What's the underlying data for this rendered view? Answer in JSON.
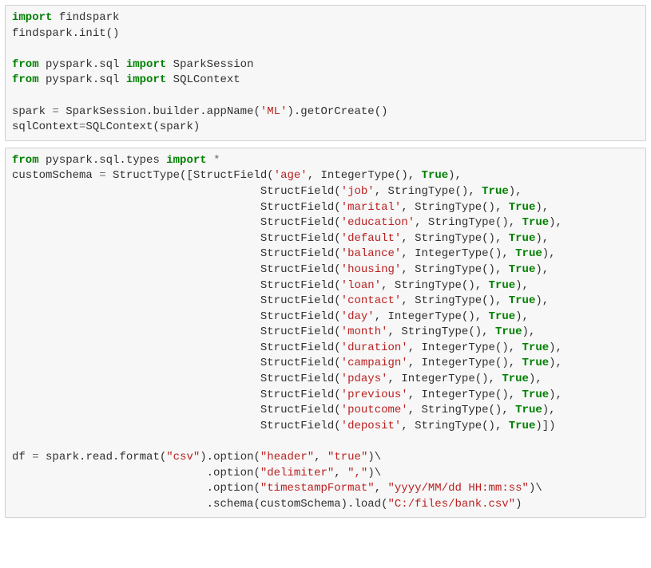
{
  "kw": {
    "import": "import",
    "from": "from",
    "star": "*"
  },
  "bool": {
    "True": "True"
  },
  "cell1": {
    "findspark": "findspark",
    "findspark_init": "findspark.init()",
    "pyspark_sql": "pyspark.sql",
    "SparkSession": "SparkSession",
    "SQLContext": "SQLContext",
    "spark": "spark",
    "eq": "=",
    "builder": "SparkSession.builder.appName(",
    "ml_str": "'ML'",
    "getOrCreate": ").getOrCreate()",
    "sqlctx_lhs": "sqlContext",
    "sqlctx_rhs1": "SQLContext(spark",
    "sqlctx_rhs2": ")"
  },
  "cell2": {
    "pyspark_sql_types": "pyspark.sql.types",
    "customSchema": "customSchema",
    "eq": "=",
    "StructType_open": "StructType([StructField(",
    "StructField_open": "StructField(",
    "mid": ", ",
    "IntegerType": "IntegerType(), ",
    "StringType": "StringType(), ",
    "close_item": "),",
    "close_last": ")])",
    "fields": {
      "age": "'age'",
      "job": "'job'",
      "marital": "'marital'",
      "education": "'education'",
      "default": "'default'",
      "balance": "'balance'",
      "housing": "'housing'",
      "loan": "'loan'",
      "contact": "'contact'",
      "day": "'day'",
      "month": "'month'",
      "duration": "'duration'",
      "campaign": "'campaign'",
      "pdays": "'pdays'",
      "previous": "'previous'",
      "poutcome": "'poutcome'",
      "deposit": "'deposit'"
    },
    "df": "df",
    "read_format": "spark.read.format(",
    "csv": "\"csv\"",
    "option": ").option(",
    "header": "\"header\"",
    "true_str": "\"true\"",
    "bsl": ")\\",
    "dot_option": ".option(",
    "delimiter": "\"delimiter\"",
    "comma": "\",\"",
    "tsfmt": "\"timestampFormat\"",
    "tsfmt_val": "\"yyyy/MM/dd HH:mm:ss\"",
    "dot_schema": ".schema(customSchema).load(",
    "path": "\"C:/files/bank.csv\"",
    "close_paren": ")"
  }
}
